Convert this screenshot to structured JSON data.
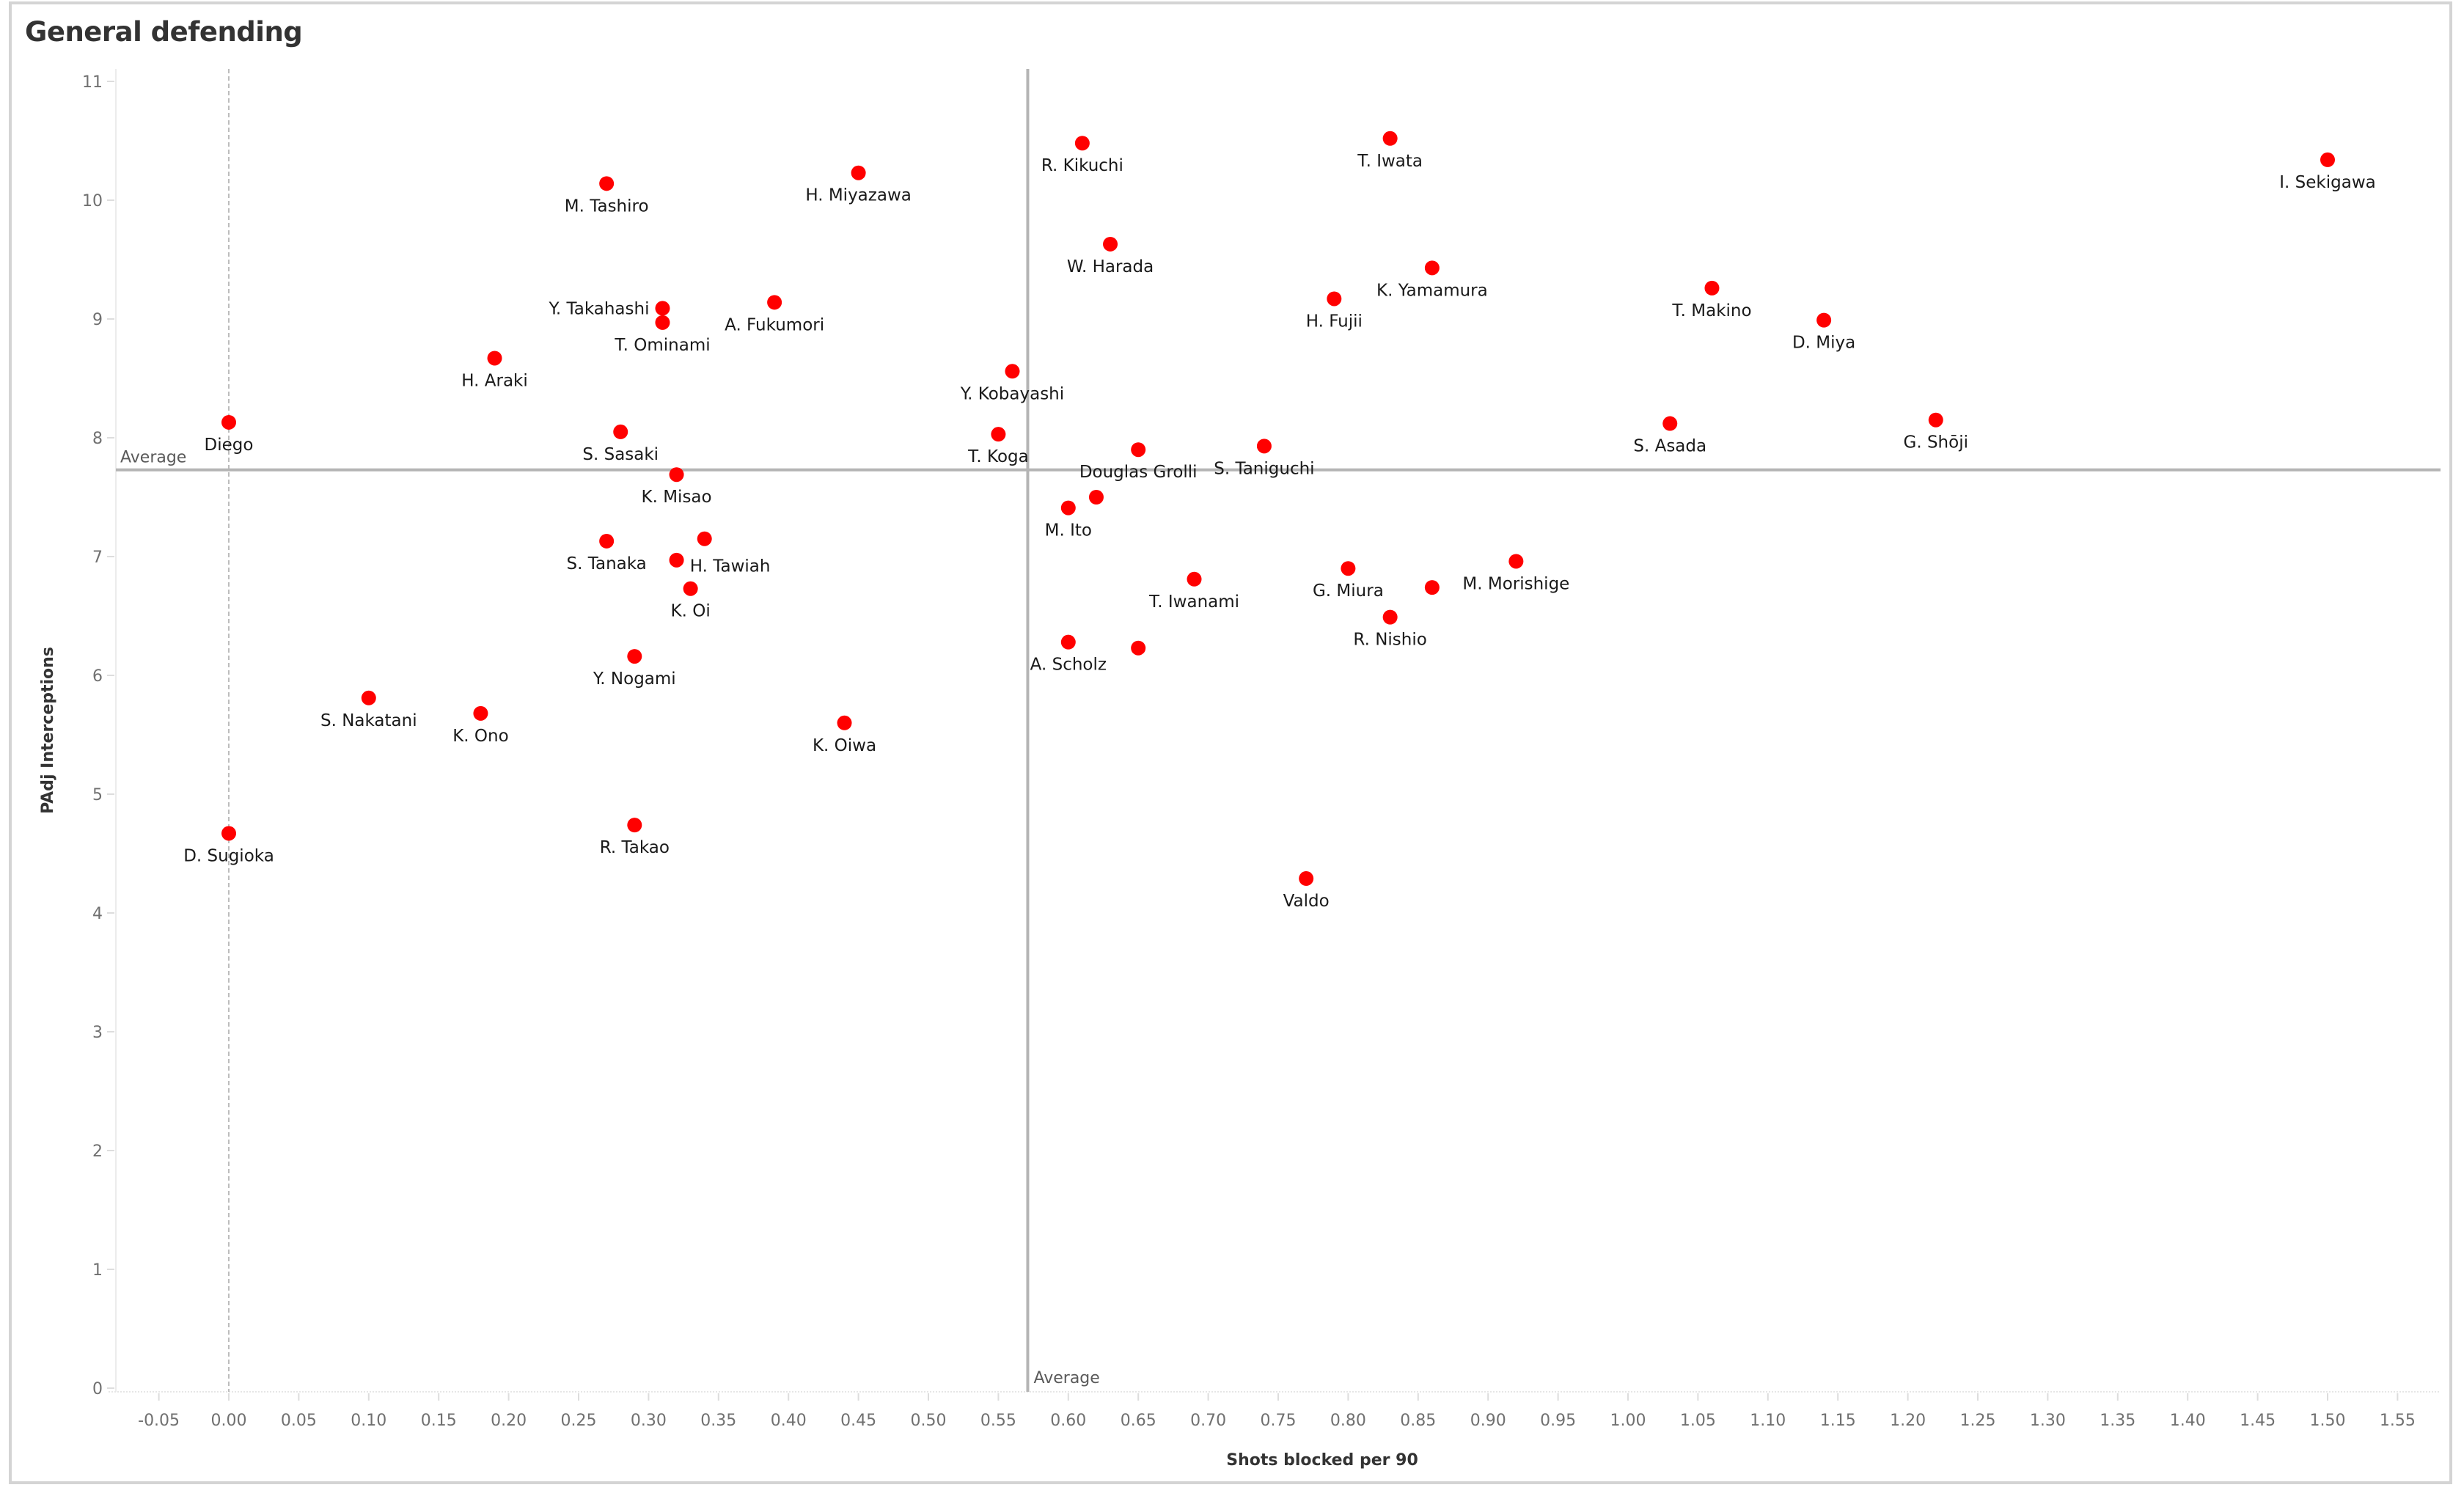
{
  "chart_data": {
    "type": "scatter",
    "title": "General defending",
    "xlabel": "Shots blocked per 90",
    "ylabel": "PAdj Interceptions",
    "xlim": [
      -0.08,
      1.58
    ],
    "ylim": [
      0,
      11.1
    ],
    "x_ticks": [
      "-0.05",
      "0.00",
      "0.05",
      "0.10",
      "0.15",
      "0.20",
      "0.25",
      "0.30",
      "0.35",
      "0.40",
      "0.45",
      "0.50",
      "0.55",
      "0.60",
      "0.65",
      "0.70",
      "0.75",
      "0.80",
      "0.85",
      "0.90",
      "0.95",
      "1.00",
      "1.05",
      "1.10",
      "1.15",
      "1.20",
      "1.25",
      "1.30",
      "1.35",
      "1.40",
      "1.45",
      "1.50",
      "1.55"
    ],
    "y_ticks": [
      "0",
      "1",
      "2",
      "3",
      "4",
      "5",
      "6",
      "7",
      "8",
      "9",
      "10",
      "11"
    ],
    "grid": false,
    "zero_line_x": true,
    "marker_color": "#ff0000",
    "reference_lines": [
      {
        "axis": "x",
        "value": 0.571,
        "label": "Average"
      },
      {
        "axis": "y",
        "value": 7.73,
        "label": "Average"
      }
    ],
    "points": [
      {
        "name": "Diego",
        "x": 0.0,
        "y": 8.13,
        "label_pos": "below"
      },
      {
        "name": "M. Tashiro",
        "x": 0.27,
        "y": 10.14,
        "label_pos": "below"
      },
      {
        "name": "H. Miyazawa",
        "x": 0.45,
        "y": 10.23,
        "label_pos": "below"
      },
      {
        "name": "R. Kikuchi",
        "x": 0.61,
        "y": 10.48,
        "label_pos": "below"
      },
      {
        "name": "T. Iwata",
        "x": 0.83,
        "y": 10.52,
        "label_pos": "below"
      },
      {
        "name": "I. Sekigawa",
        "x": 1.5,
        "y": 10.34,
        "label_pos": "below"
      },
      {
        "name": "W. Harada",
        "x": 0.63,
        "y": 9.63,
        "label_pos": "below"
      },
      {
        "name": "K. Yamamura",
        "x": 0.86,
        "y": 9.43,
        "label_pos": "below"
      },
      {
        "name": "H. Fujii",
        "x": 0.79,
        "y": 9.17,
        "label_pos": "below"
      },
      {
        "name": "T. Makino",
        "x": 1.06,
        "y": 9.26,
        "label_pos": "below"
      },
      {
        "name": "D. Miya",
        "x": 1.14,
        "y": 8.99,
        "label_pos": "below"
      },
      {
        "name": "Y. Takahashi",
        "x": 0.31,
        "y": 9.09,
        "label_pos": "left"
      },
      {
        "name": "T. Ominami",
        "x": 0.31,
        "y": 8.97,
        "label_pos": "below"
      },
      {
        "name": "A. Fukumori",
        "x": 0.39,
        "y": 9.14,
        "label_pos": "below"
      },
      {
        "name": "H. Araki",
        "x": 0.19,
        "y": 8.67,
        "label_pos": "below"
      },
      {
        "name": "Y. Kobayashi",
        "x": 0.56,
        "y": 8.56,
        "label_pos": "below"
      },
      {
        "name": "S. Sasaki",
        "x": 0.28,
        "y": 8.05,
        "label_pos": "below"
      },
      {
        "name": "T. Koga",
        "x": 0.55,
        "y": 8.03,
        "label_pos": "below"
      },
      {
        "name": "S. Asada",
        "x": 1.03,
        "y": 8.12,
        "label_pos": "below"
      },
      {
        "name": "G. Shōji",
        "x": 1.22,
        "y": 8.15,
        "label_pos": "below"
      },
      {
        "name": "Douglas Grolli",
        "x": 0.65,
        "y": 7.9,
        "label_pos": "below"
      },
      {
        "name": "S. Taniguchi",
        "x": 0.74,
        "y": 7.93,
        "label_pos": "below"
      },
      {
        "name": "K. Misao",
        "x": 0.32,
        "y": 7.69,
        "label_pos": "below"
      },
      {
        "name": "M. Ito",
        "x": 0.6,
        "y": 7.41,
        "label_pos": "below"
      },
      {
        "name": "",
        "x": 0.62,
        "y": 7.5,
        "label_pos": "none"
      },
      {
        "name": "S. Tanaka",
        "x": 0.27,
        "y": 7.13,
        "label_pos": "below"
      },
      {
        "name": "H. Tawiah",
        "x": 0.34,
        "y": 7.15,
        "label_pos": "below-right"
      },
      {
        "name": "",
        "x": 0.32,
        "y": 6.97,
        "label_pos": "none"
      },
      {
        "name": "K. Oi",
        "x": 0.33,
        "y": 6.73,
        "label_pos": "below"
      },
      {
        "name": "T. Iwanami",
        "x": 0.69,
        "y": 6.81,
        "label_pos": "below"
      },
      {
        "name": "G. Miura",
        "x": 0.8,
        "y": 6.9,
        "label_pos": "below"
      },
      {
        "name": "M. Morishige",
        "x": 0.92,
        "y": 6.96,
        "label_pos": "below"
      },
      {
        "name": "",
        "x": 0.86,
        "y": 6.74,
        "label_pos": "none"
      },
      {
        "name": "R. Nishio",
        "x": 0.83,
        "y": 6.49,
        "label_pos": "below"
      },
      {
        "name": "A. Scholz",
        "x": 0.6,
        "y": 6.28,
        "label_pos": "below"
      },
      {
        "name": "",
        "x": 0.65,
        "y": 6.23,
        "label_pos": "none"
      },
      {
        "name": "Y. Nogami",
        "x": 0.29,
        "y": 6.16,
        "label_pos": "below"
      },
      {
        "name": "S. Nakatani",
        "x": 0.1,
        "y": 5.81,
        "label_pos": "below"
      },
      {
        "name": "K. Ono",
        "x": 0.18,
        "y": 5.68,
        "label_pos": "below"
      },
      {
        "name": "K. Oiwa",
        "x": 0.44,
        "y": 5.6,
        "label_pos": "below"
      },
      {
        "name": "D. Sugioka",
        "x": 0.0,
        "y": 4.67,
        "label_pos": "below"
      },
      {
        "name": "R. Takao",
        "x": 0.29,
        "y": 4.74,
        "label_pos": "below"
      },
      {
        "name": "Valdo",
        "x": 0.77,
        "y": 4.29,
        "label_pos": "below"
      }
    ]
  }
}
